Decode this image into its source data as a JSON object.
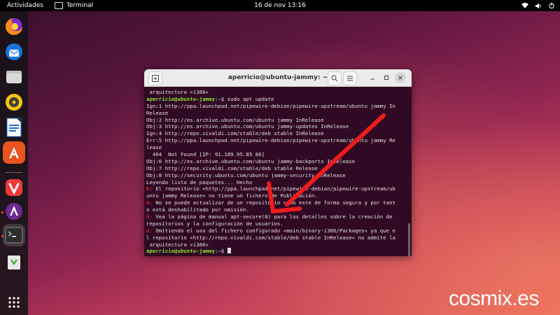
{
  "topbar": {
    "activities": "Actividades",
    "app_name": "Terminal",
    "datetime": "16 de nov  13:16"
  },
  "dock": {
    "items": [
      "Firefox",
      "Thunderbird",
      "Archivos",
      "Rhythmbox",
      "LibreOffice Writer",
      "Ubuntu Software",
      "Vivaldi",
      "Actualizador",
      "Terminal",
      "Papelera",
      "Mostrar aplicaciones"
    ]
  },
  "terminal": {
    "title": "aperricio@ubuntu-jammy: ~",
    "prompt_user": "aperricio@ubuntu-jammy",
    "prompt_path": "~",
    "lines": [
      {
        "kind": "text",
        "text": " arquitectura «i386»"
      },
      {
        "kind": "prompt",
        "cmd": "sudo apt update"
      },
      {
        "kind": "text",
        "text": "Ign:1 http://ppa.launchpad.net/pipewire-debian/pipewire-upstream/ubuntu jammy In"
      },
      {
        "kind": "text",
        "text": "Release"
      },
      {
        "kind": "text",
        "text": "Obj:2 http://es.archive.ubuntu.com/ubuntu jammy InRelease"
      },
      {
        "kind": "text",
        "text": "Obj:3 http://es.archive.ubuntu.com/ubuntu jammy-updates InRelease"
      },
      {
        "kind": "text",
        "text": "Ign:4 http://repo.vivaldi.com/stable/deb stable InRelease"
      },
      {
        "kind": "text",
        "text": "Err:5 http://ppa.launchpad.net/pipewire-debian/pipewire-upstream/ubuntu jammy Re"
      },
      {
        "kind": "text",
        "text": "lease"
      },
      {
        "kind": "text",
        "text": "  404  Not Found [IP: 91.189.95.85 80]"
      },
      {
        "kind": "text",
        "text": "Obj:6 http://es.archive.ubuntu.com/ubuntu jammy-backports InRelease"
      },
      {
        "kind": "text",
        "text": "Obj:7 http://repo.vivaldi.com/stable/deb stable Release"
      },
      {
        "kind": "text",
        "text": "Obj:8 http://security.ubuntu.com/ubuntu jammy-security InRelease"
      },
      {
        "kind": "text",
        "text": "Leyendo lista de paquetes... Hecho"
      },
      {
        "kind": "err",
        "prefix": "E:",
        "text": " El repositorio «http://ppa.launchpad.net/pipewire-debian/pipewire-upstream/ub"
      },
      {
        "kind": "text",
        "text": "untu jammy Release» no tiene un fichero de Publicación."
      },
      {
        "kind": "note",
        "prefix": "N:",
        "text": " No se puede actualizar de un repositorio como este de forma segura y por tant"
      },
      {
        "kind": "text",
        "text": "o está deshabilitado por omisión."
      },
      {
        "kind": "note",
        "prefix": "N:",
        "text": " Vea la página de manual apt-secure(8) para los detalles sobre la creación de"
      },
      {
        "kind": "text",
        "text": "repositorios y la configuración de usuarios."
      },
      {
        "kind": "note",
        "prefix": "N:",
        "text": " Omitiendo el uso del fichero configurado «main/binary-i386/Packages» ya que e"
      },
      {
        "kind": "text",
        "text": "l repositorio «http://repo.vivaldi.com/stable/deb stable InRelease» no admite la"
      },
      {
        "kind": "text",
        "text": " arquitectura «i386»"
      },
      {
        "kind": "prompt_cursor",
        "cmd": ""
      }
    ]
  },
  "brand": "cosmix.es",
  "colors": {
    "arrow": "#ee1c1c",
    "prompt_user": "#8ae234",
    "prompt_path": "#729fcf",
    "terminal_bg": "#300a24"
  }
}
